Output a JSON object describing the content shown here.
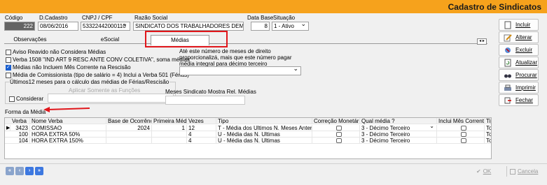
{
  "window": {
    "title": "Cadastro de Sindicatos"
  },
  "header": {
    "codigo_label": "Código",
    "codigo_value": "222",
    "dcadastro_label": "D.Cadastro",
    "dcadastro_value": "08/06/2016",
    "cnpj_label": "CNPJ / CPF",
    "cnpj_value": "53322442000110",
    "razao_label": "Razão Social",
    "razao_value": "SINDICATO DOS TRABALHADORES DEMONS",
    "database_label": "Data Base",
    "database_value": "8",
    "situacao_label": "Situação",
    "situacao_value": "1 - Ativo"
  },
  "tabs": [
    "Observações",
    "eSocial",
    "Médias"
  ],
  "options": {
    "aviso": "Aviso Reavido não Considera Médias",
    "verba1508": "Verba 1508 \"IND ART 9 RESC ANTE CONV COLETIVA\", soma médias",
    "mesCorrente": "Médias não Incluem Mês Corrente na Rescisão",
    "comissionista": "Média de Comissionista (tipo de salário = 4) Inclui a Verba 501 (Férias)",
    "ultimos12_group": "Últimos12 meses para o cálculo das médias de Férias/Rescisão",
    "considerar": "Considerar",
    "aplicar": "Aplicar Somente as Funções",
    "meses_proporcional": "Até este número de meses de direito proporcionalizá, mais que este número pagar média integral para décimo terceiro",
    "meses_sindicato": "Meses Sindicato Mostra Rel. Médias"
  },
  "forma_label": "Forma da Média",
  "grid": {
    "headers": [
      "Verba",
      "Nome Verba",
      "Base de Ocorrência",
      "Primeira Média",
      "Vezes",
      "Tipo",
      "Correção Monetária?",
      "Qual média ?",
      "Inclui Mês Corrente",
      "Tip"
    ],
    "rows": [
      {
        "verba": "3423",
        "nome": "COMISSAO",
        "base": "2024",
        "primeira": "1",
        "vezes": "12",
        "tipo": "T - Média dos Ultimos N. Meses Anteriores ac",
        "qual": "3 - Décimo Terceiro",
        "tip": "Toc"
      },
      {
        "verba": "100",
        "nome": "HORA EXTRA 50%",
        "base": "",
        "primeira": "",
        "vezes": "4",
        "tipo": "U - Média das  N. Ultimas",
        "qual": "3 - Décimo Terceiro",
        "tip": "Toc"
      },
      {
        "verba": "104",
        "nome": "HORA EXTRA 150%",
        "base": "",
        "primeira": "",
        "vezes": "4",
        "tipo": "U - Média das  N. Ultimas",
        "qual": "3 - Décimo Terceiro",
        "tip": "Toc"
      }
    ]
  },
  "sidebar": [
    "Incluir",
    "Alterar",
    "Excluir",
    "Atualizar",
    "Procurar",
    "Imprimir",
    "Fechar"
  ],
  "bottom": {
    "ok": "OK",
    "cancel": "Cancela"
  },
  "colors": {
    "titlebar": "#f6a21c",
    "highlight": "#e0161b"
  }
}
